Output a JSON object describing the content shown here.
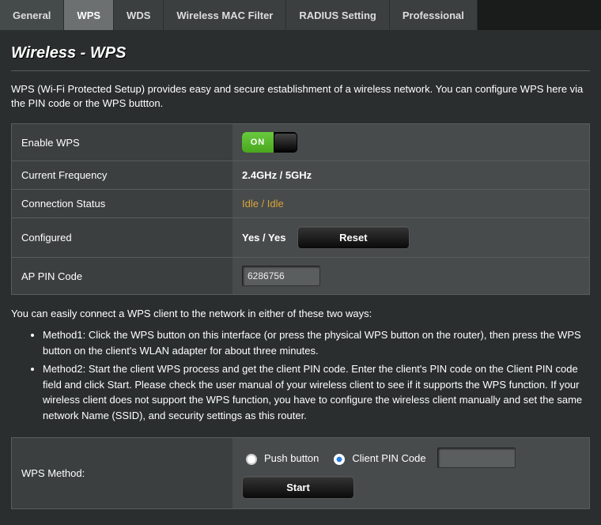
{
  "tabs": {
    "items": [
      {
        "label": "General"
      },
      {
        "label": "WPS"
      },
      {
        "label": "WDS"
      },
      {
        "label": "Wireless MAC Filter"
      },
      {
        "label": "RADIUS Setting"
      },
      {
        "label": "Professional"
      }
    ],
    "activeIndex": 1
  },
  "page": {
    "title": "Wireless - WPS",
    "description": "WPS (Wi-Fi Protected Setup) provides easy and secure establishment of a wireless network. You can configure WPS here via the PIN code or the WPS buttton."
  },
  "settings": {
    "enableWps": {
      "label": "Enable WPS",
      "value": "ON"
    },
    "currentFrequency": {
      "label": "Current Frequency",
      "value": "2.4GHz / 5GHz"
    },
    "connectionStatus": {
      "label": "Connection Status",
      "value": "Idle / Idle"
    },
    "configured": {
      "label": "Configured",
      "value": "Yes / Yes",
      "resetLabel": "Reset"
    },
    "apPinCode": {
      "label": "AP PIN Code",
      "value": "6286756"
    }
  },
  "help": {
    "intro": "You can easily connect a WPS client to the network in either of these two ways:",
    "methods": [
      "Method1: Click the WPS button on this interface (or press the physical WPS button on the router), then press the WPS button on the client's WLAN adapter for about three minutes.",
      "Method2: Start the client WPS process and get the client PIN code. Enter the client's PIN code on the Client PIN code field and click Start. Please check the user manual of your wireless client to see if it supports the WPS function. If your wireless client does not support the WPS function, you have to configure the wireless client manually and set the same network Name (SSID), and security settings as this router."
    ]
  },
  "wpsMethod": {
    "label": "WPS Method:",
    "options": {
      "pushButton": "Push button",
      "clientPin": "Client PIN Code"
    },
    "selected": "clientPin",
    "clientPinValue": "",
    "startLabel": "Start"
  }
}
